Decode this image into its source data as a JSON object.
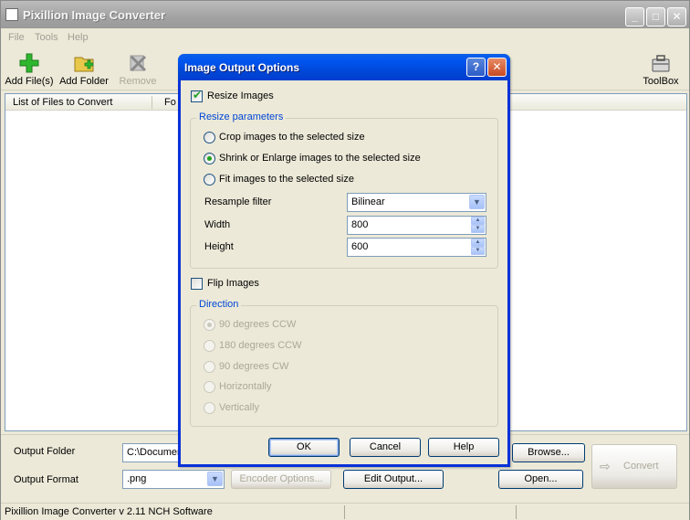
{
  "app": {
    "title": "Pixillion Image Converter",
    "menu": [
      "File",
      "Tools",
      "Help"
    ],
    "toolbar": {
      "add_files": "Add File(s)",
      "add_folder": "Add Folder",
      "remove": "Remove",
      "toolbox": "ToolBox"
    },
    "file_list": {
      "col_files": "List of Files to Convert",
      "col_format": "Fo"
    },
    "output": {
      "folder_label": "Output Folder",
      "folder_value": "C:\\Documen",
      "format_label": "Output Format",
      "format_value": ".png",
      "encoder_options": "Encoder Options...",
      "edit_output": "Edit Output...",
      "browse": "Browse...",
      "open": "Open...",
      "convert": "Convert"
    },
    "status": "Pixillion Image Converter v 2.11  NCH Software"
  },
  "dialog": {
    "title": "Image Output Options",
    "resize_images": {
      "label": "Resize Images",
      "checked": true
    },
    "resize_params": {
      "legend": "Resize parameters",
      "options": [
        {
          "label": "Crop images to the selected size",
          "selected": false
        },
        {
          "label": "Shrink or Enlarge images to the selected size",
          "selected": true
        },
        {
          "label": "Fit images to the selected size",
          "selected": false
        }
      ],
      "resample_label": "Resample filter",
      "resample_value": "Bilinear",
      "width_label": "Width",
      "width_value": "800",
      "height_label": "Height",
      "height_value": "600"
    },
    "flip_images": {
      "label": "Flip Images",
      "checked": false
    },
    "direction": {
      "legend": "Direction",
      "options": [
        {
          "label": "90 degrees CCW",
          "selected": true
        },
        {
          "label": "180 degrees CCW",
          "selected": false
        },
        {
          "label": "90 degrees CW",
          "selected": false
        },
        {
          "label": "Horizontally",
          "selected": false
        },
        {
          "label": "Vertically",
          "selected": false
        }
      ]
    },
    "buttons": {
      "ok": "OK",
      "cancel": "Cancel",
      "help": "Help"
    }
  },
  "colors": {
    "accent": "#0046d5",
    "check": "#21a121"
  }
}
